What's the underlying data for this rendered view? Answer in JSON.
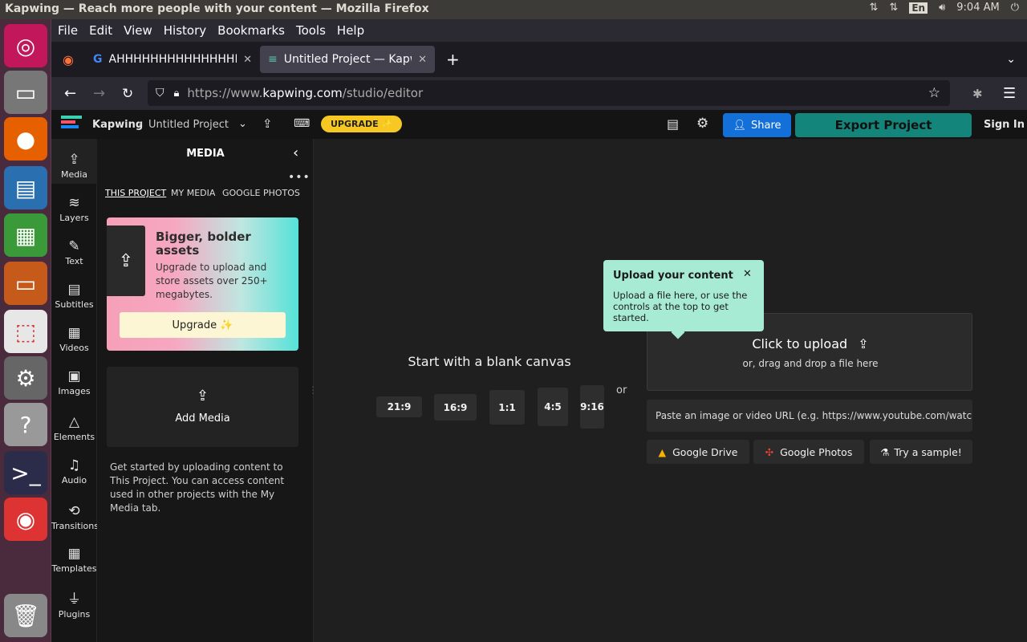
{
  "os": {
    "window_title": "Kapwing — Reach more people with your content — Mozilla Firefox",
    "lang": "En",
    "time": "9:04 AM"
  },
  "menubar": [
    "File",
    "Edit",
    "View",
    "History",
    "Bookmarks",
    "Tools",
    "Help"
  ],
  "tabs": [
    {
      "title": "AHHHHHHHHHHHHHHHHHH",
      "active": false
    },
    {
      "title": "Untitled Project — Kapwing",
      "active": true
    }
  ],
  "url": {
    "prefix": "https://www.",
    "domain": "kapwing.com",
    "path": "/studio/editor"
  },
  "app": {
    "brand": "Kapwing",
    "separator": "›",
    "project_name": "Untitled Project",
    "upgrade_badge": "UPGRADE ✨",
    "share_label": "Share",
    "export_label": "Export Project",
    "signin_label": "Sign In"
  },
  "rail": [
    {
      "label": "Media",
      "icon": "upload-icon",
      "glyph": "⇪"
    },
    {
      "label": "Layers",
      "icon": "layers-icon",
      "glyph": "≋"
    },
    {
      "label": "Text",
      "icon": "text-icon",
      "glyph": "✎"
    },
    {
      "label": "Subtitles",
      "icon": "subtitles-icon",
      "glyph": "▤"
    },
    {
      "label": "Videos",
      "icon": "film-icon",
      "glyph": "▦"
    },
    {
      "label": "Images",
      "icon": "image-icon",
      "glyph": "▣"
    },
    {
      "label": "Elements",
      "icon": "shapes-icon",
      "glyph": "△"
    },
    {
      "label": "Audio",
      "icon": "music-icon",
      "glyph": "♫"
    },
    {
      "label": "Transitions",
      "icon": "transition-icon",
      "glyph": "⟲"
    },
    {
      "label": "Templates",
      "icon": "grid-icon",
      "glyph": "▦"
    },
    {
      "label": "Plugins",
      "icon": "plug-icon",
      "glyph": "⏚"
    }
  ],
  "media": {
    "heading": "MEDIA",
    "tabs": [
      "THIS PROJECT",
      "MY MEDIA",
      "GOOGLE PHOTOS"
    ],
    "promo": {
      "title": "Bigger, bolder assets",
      "text": "Upgrade to upload and store assets over 250+ megabytes.",
      "button": "Upgrade ✨"
    },
    "add_media": "Add Media",
    "help_text": "Get started by uploading content to This Project. You can access content used in other projects with the My Media tab."
  },
  "canvas": {
    "blank_title": "Start with a blank canvas",
    "ratios": [
      "21:9",
      "16:9",
      "1:1",
      "4:5",
      "9:16"
    ],
    "or": "or",
    "tooltip": {
      "title": "Upload your content",
      "text": "Upload a file here, or use the controls at the top to get started."
    },
    "upload_title": "Click to upload",
    "upload_sub": "or, drag and drop a file here",
    "url_placeholder": "Paste an image or video URL (e.g. https://www.youtube.com/watch?v",
    "sources": [
      "Google Drive",
      "Google Photos",
      "Try a sample!"
    ]
  }
}
